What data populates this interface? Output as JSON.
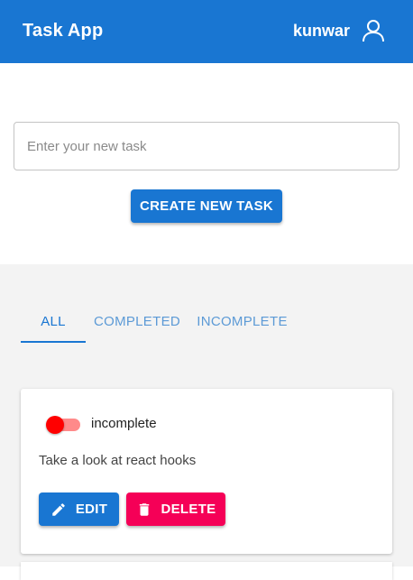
{
  "header": {
    "title": "Task App",
    "username": "kunwar",
    "user_icon": "person-outline-icon"
  },
  "create": {
    "placeholder": "Enter your new task",
    "value": "",
    "button_label": "CREATE NEW TASK"
  },
  "tabs": [
    {
      "label": "ALL",
      "active": true
    },
    {
      "label": "COMPLETED",
      "active": false
    },
    {
      "label": "INCOMPLETE",
      "active": false
    }
  ],
  "tasks": [
    {
      "status": "incomplete",
      "completed": false,
      "text": "Take a look at react hooks",
      "edit_label": "EDIT",
      "edit_icon": "pencil-icon",
      "delete_label": "DELETE",
      "delete_icon": "trash-icon"
    }
  ],
  "colors": {
    "primary": "#1976d2",
    "secondary": "#f50057",
    "switch_off": "#ff0000",
    "background": "#f3f3f3"
  }
}
